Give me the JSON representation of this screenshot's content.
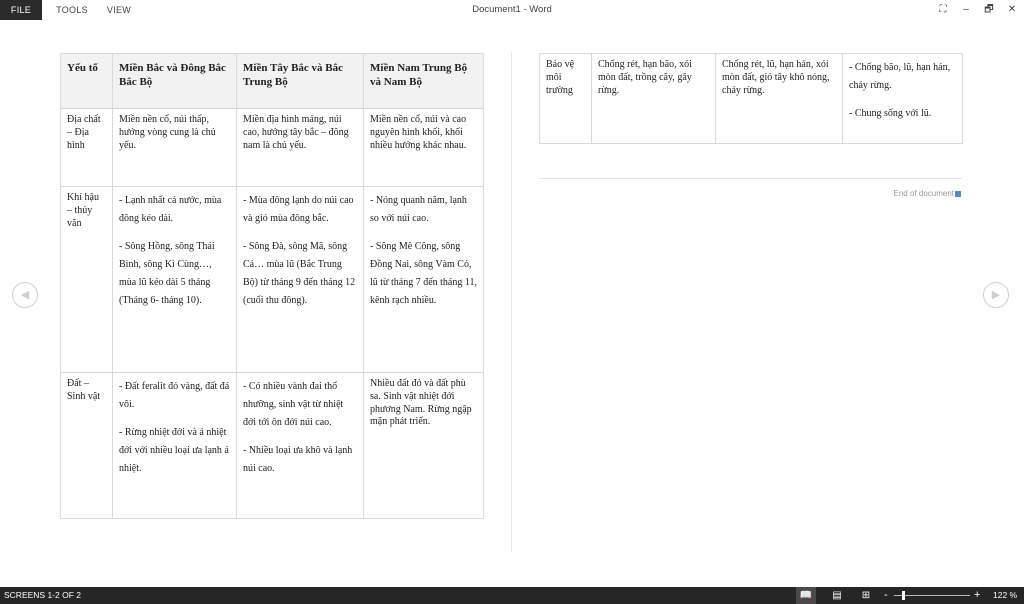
{
  "menu": {
    "file": "FILE",
    "tools": "TOOLS",
    "view": "VIEW"
  },
  "window": {
    "title": "Document1 - Word",
    "controls": {
      "fullscreen": "⛶",
      "minimize": "–",
      "restore": "🗗",
      "close": "✕"
    }
  },
  "table1": {
    "headers": [
      "Yếu tố",
      "Miền Bắc và Đông Bắc Bắc Bộ",
      "Miền Tây Bắc và Bắc Trung Bộ",
      "Miền Nam Trung Bộ và Nam Bộ"
    ],
    "rows": [
      {
        "label": "Địa chất – Địa hình",
        "col1": [
          "Miền nền cổ, núi thấp, hướng vòng cung là chủ yếu."
        ],
        "col2": [
          "Miền địa hình mảng, núi cao, hướng tây bắc – đông nam là chủ yếu."
        ],
        "col3": [
          "Miền nền cổ, núi và cao nguyên hình khối, khối nhiều hướng khác nhau."
        ]
      },
      {
        "label": "Khí hậu – thủy văn",
        "col1": [
          "- Lạnh nhất cả nước, mùa đông kéo dài.",
          "- Sông Hồng, sông Thái Bình, sông Kì Cùng…, mùa lũ kéo dài 5 tháng (Tháng 6- tháng 10)."
        ],
        "col2": [
          "- Mùa đông lạnh do núi cao và gió mùa đông bắc.",
          "- Sông Đà, sông Mã, sông Cả… mùa lũ (Bắc Trung Bộ) từ tháng 9 đến tháng 12 (cuối thu đông)."
        ],
        "col3": [
          "- Nóng quanh năm, lạnh so với núi cao.",
          "- Sông Mê Công, sông Đồng Nai, sông Vàm Cỏ, lũ từ tháng 7 đến tháng 11, kênh rạch nhiều."
        ]
      },
      {
        "label": "Đất – Sinh vật",
        "col1": [
          "- Đất feralit đỏ vàng, đất đá vôi.",
          "- Rừng nhiệt đới và á nhiệt đới với nhiều loại ưa lạnh á nhiệt."
        ],
        "col2": [
          "- Có nhiều vành đai thổ nhưỡng, sinh vật từ nhiệt đới tới ôn đới núi cao.",
          "- Nhiều loại ưa khô và lạnh núi cao."
        ],
        "col3": [
          "Nhiều đất đỏ và đất phù sa. Sinh vật nhiệt đới phương Nam. Rừng ngập mặn phát triển."
        ]
      }
    ]
  },
  "table2": {
    "rows": [
      {
        "label": "Bảo vệ môi trường",
        "col1": [
          "Chống rét, hạn bão, xói mòn đất, trồng cây, gây rừng."
        ],
        "col2": [
          "Chống rét, lũ, hạn hán, xói mòn đất, gió tây khô nóng, cháy rừng."
        ],
        "col3": [
          "- Chống bão, lũ, hạn hán, cháy rừng.",
          "- Chung sống với lũ."
        ]
      }
    ]
  },
  "end_of_document": "End of document",
  "nav": {
    "prev": "◀",
    "next": "▶"
  },
  "status": {
    "screens": "SCREENS 1-2 OF 2",
    "zoom": "122 %",
    "zoom_minus": "-",
    "zoom_plus": "+",
    "view_icons": {
      "read": "📖",
      "print": "▤",
      "web": "⊞"
    }
  },
  "colors": {
    "statusbar": "#262626",
    "file_tab": "#2b2b2b",
    "header_bg": "#f2f2f2",
    "end_marker": "#5b86c0"
  }
}
